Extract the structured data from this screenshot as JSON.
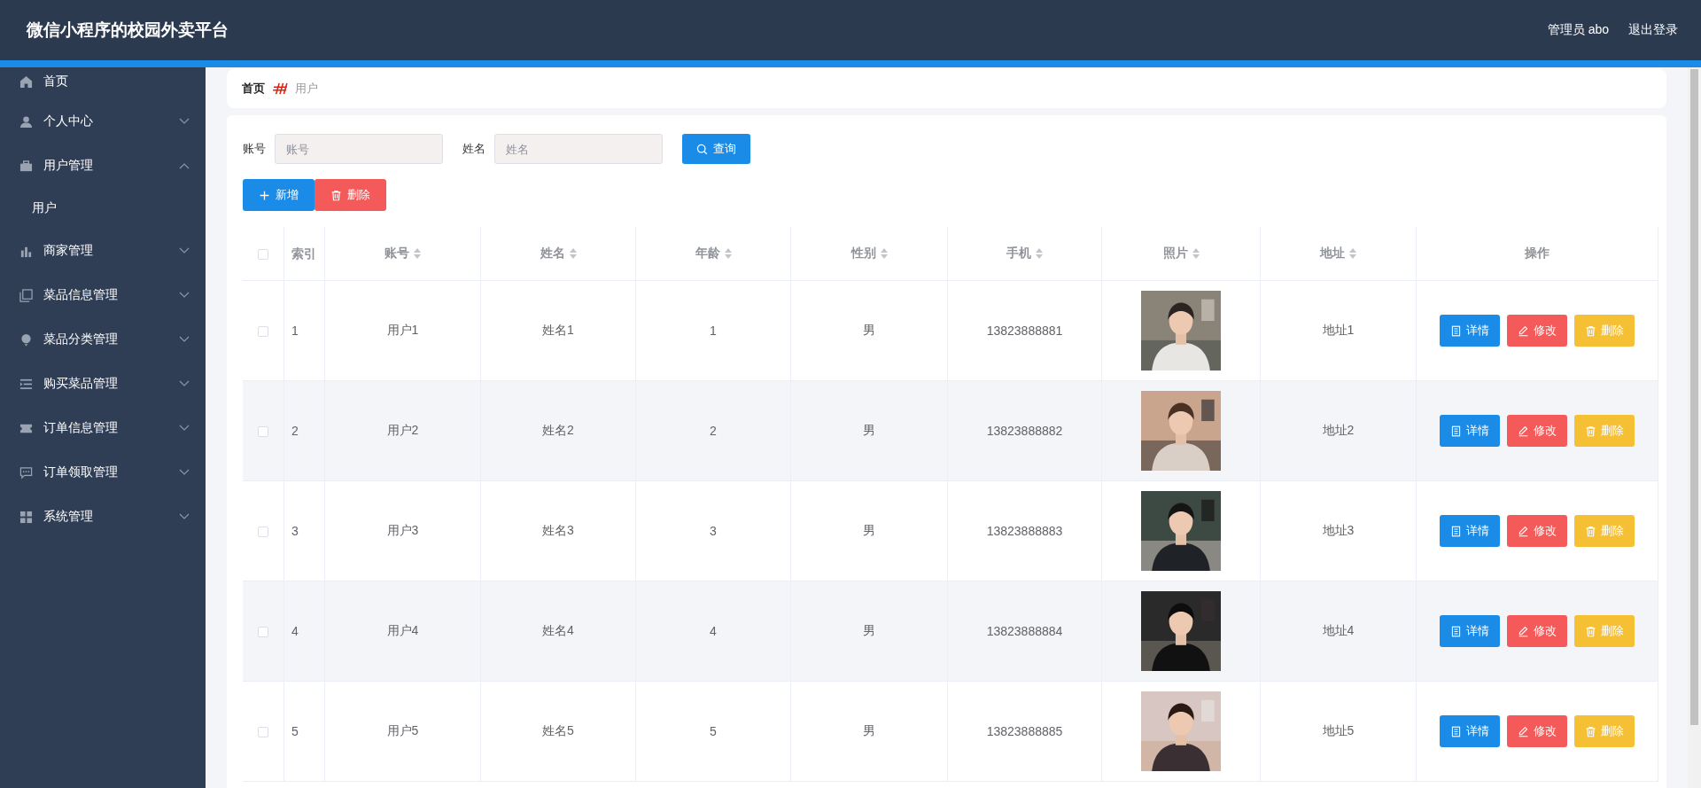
{
  "header": {
    "title": "微信小程序的校园外卖平台",
    "user": "管理员 abo",
    "logout": "退出登录"
  },
  "sidebar": {
    "items": [
      {
        "label": "首页",
        "kind": "home"
      },
      {
        "label": "个人中心",
        "kind": "user",
        "expanded": false
      },
      {
        "label": "用户管理",
        "kind": "briefcase",
        "expanded": true,
        "children": [
          {
            "label": "用户"
          }
        ]
      },
      {
        "label": "商家管理",
        "kind": "chart",
        "expanded": false
      },
      {
        "label": "菜品信息管理",
        "kind": "copy",
        "expanded": false
      },
      {
        "label": "菜品分类管理",
        "kind": "balloon",
        "expanded": false
      },
      {
        "label": "购买菜品管理",
        "kind": "list",
        "expanded": false
      },
      {
        "label": "订单信息管理",
        "kind": "ticket",
        "expanded": false
      },
      {
        "label": "订单领取管理",
        "kind": "chat",
        "expanded": false
      },
      {
        "label": "系统管理",
        "kind": "grid",
        "expanded": false
      }
    ]
  },
  "breadcrumb": [
    "首页",
    "用户"
  ],
  "search": {
    "fields": [
      {
        "label": "账号",
        "placeholder": "账号"
      },
      {
        "label": "姓名",
        "placeholder": "姓名"
      }
    ],
    "button": "查询"
  },
  "actions": [
    {
      "label": "新增",
      "kind": "add"
    },
    {
      "label": "删除",
      "kind": "delete"
    }
  ],
  "table": {
    "all_selected": false,
    "columns": [
      {
        "label": "索引",
        "sortable": false
      },
      {
        "label": "账号",
        "sortable": true
      },
      {
        "label": "姓名",
        "sortable": true
      },
      {
        "label": "年龄",
        "sortable": true
      },
      {
        "label": "性别",
        "sortable": true
      },
      {
        "label": "手机",
        "sortable": true
      },
      {
        "label": "照片",
        "sortable": true
      },
      {
        "label": "地址",
        "sortable": true
      },
      {
        "label": "操作",
        "sortable": false
      }
    ],
    "rows": [
      {
        "selected": false,
        "cells": [
          "1",
          "用户1",
          "姓名1",
          "1",
          "男",
          "13823888881"
        ],
        "address": "地址1",
        "actions": [
          {
            "label": "详情",
            "kind": "detail"
          },
          {
            "label": "修改",
            "kind": "edit"
          },
          {
            "label": "删除",
            "kind": "delete"
          }
        ]
      },
      {
        "selected": false,
        "cells": [
          "2",
          "用户2",
          "姓名2",
          "2",
          "男",
          "13823888882"
        ],
        "address": "地址2",
        "actions": [
          {
            "label": "详情",
            "kind": "detail"
          },
          {
            "label": "修改",
            "kind": "edit"
          },
          {
            "label": "删除",
            "kind": "delete"
          }
        ]
      },
      {
        "selected": false,
        "cells": [
          "3",
          "用户3",
          "姓名3",
          "3",
          "男",
          "13823888883"
        ],
        "address": "地址3",
        "actions": [
          {
            "label": "详情",
            "kind": "detail"
          },
          {
            "label": "修改",
            "kind": "edit"
          },
          {
            "label": "删除",
            "kind": "delete"
          }
        ]
      },
      {
        "selected": false,
        "cells": [
          "4",
          "用户4",
          "姓名4",
          "4",
          "男",
          "13823888884"
        ],
        "address": "地址4",
        "actions": [
          {
            "label": "详情",
            "kind": "detail"
          },
          {
            "label": "修改",
            "kind": "edit"
          },
          {
            "label": "删除",
            "kind": "delete"
          }
        ]
      },
      {
        "selected": false,
        "cells": [
          "5",
          "用户5",
          "姓名5",
          "5",
          "男",
          "13823888885"
        ],
        "address": "地址5",
        "actions": [
          {
            "label": "详情",
            "kind": "detail"
          },
          {
            "label": "修改",
            "kind": "edit"
          },
          {
            "label": "删除",
            "kind": "delete"
          }
        ]
      }
    ]
  }
}
